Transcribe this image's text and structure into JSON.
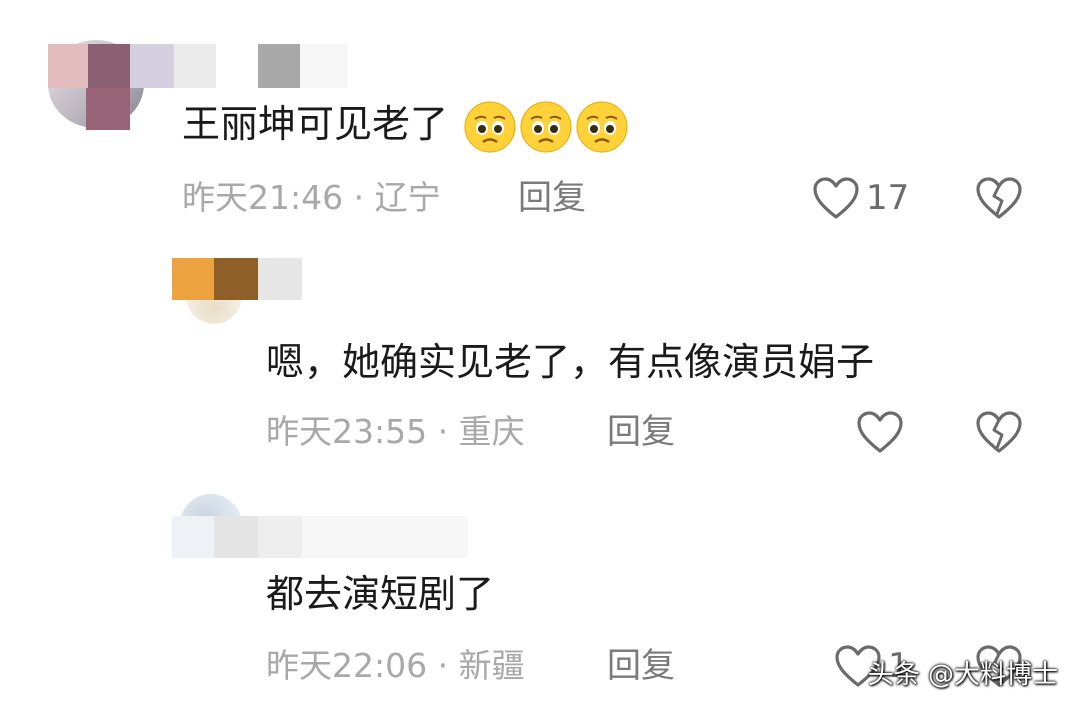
{
  "comments": [
    {
      "text": "王丽坤可见老了",
      "emoji_name": "pleading-face-emoji",
      "emoji_count": 3,
      "meta": "昨天21:46 · 辽宁",
      "reply_label": "回复",
      "like_count": "17"
    },
    {
      "text": "嗯，她确实见老了，有点像演员娟子",
      "meta": "昨天23:55 · 重庆",
      "reply_label": "回复",
      "like_count": ""
    },
    {
      "text": "都去演短剧了",
      "meta": "昨天22:06 · 新疆",
      "reply_label": "回复",
      "like_count": "1"
    }
  ],
  "icons": {
    "like": "heart-outline-icon",
    "dislike": "broken-heart-icon"
  },
  "watermark": "头条 @大料博士",
  "colors": {
    "text": "#1a1a1a",
    "meta": "#a8a8a8",
    "reply": "#7a7a7a",
    "icon": "#6b6b6b"
  }
}
